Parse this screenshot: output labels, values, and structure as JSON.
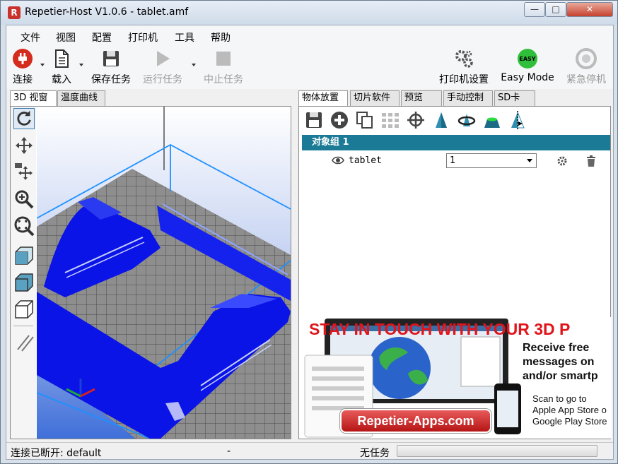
{
  "window": {
    "title": "Repetier-Host V1.0.6 - tablet.amf",
    "app_icon": "R"
  },
  "menu": [
    "文件",
    "视图",
    "配置",
    "打印机",
    "工具",
    "帮助"
  ],
  "toolbar": {
    "connect": "连接",
    "load": "载入",
    "save_job": "保存任务",
    "run_job": "运行任务",
    "stop_job": "中止任务",
    "printer_settings": "打印机设置",
    "easy_mode": "Easy Mode",
    "easy_badge": "EASY",
    "emergency_stop": "紧急停机"
  },
  "left_tabs": [
    "3D 视窗",
    "温度曲线"
  ],
  "right_tabs": [
    "物体放置",
    "切片软件",
    "预览",
    "手动控制",
    "SD卡"
  ],
  "object_group": {
    "label": "对象组 1"
  },
  "object": {
    "name": "tablet",
    "copies": "1"
  },
  "ad": {
    "headline": "STAY IN TOUCH WITH YOUR 3D P",
    "receive": [
      "Receive free",
      "messages on",
      "and/or smartp"
    ],
    "scan": [
      "Scan to go to",
      "Apple App Store o",
      "Google Play Store"
    ],
    "badge": "Repetier-Apps.com"
  },
  "status": {
    "connection": "连接已断开: default",
    "middle": "-",
    "job": "无任务",
    "progress": 0
  },
  "colors": {
    "accent": "#1b7b96",
    "model": "#0a14e6",
    "bed_grid": "#8c8c8c",
    "background_top": "#ffffff",
    "background_bottom": "#3f6fd9"
  }
}
